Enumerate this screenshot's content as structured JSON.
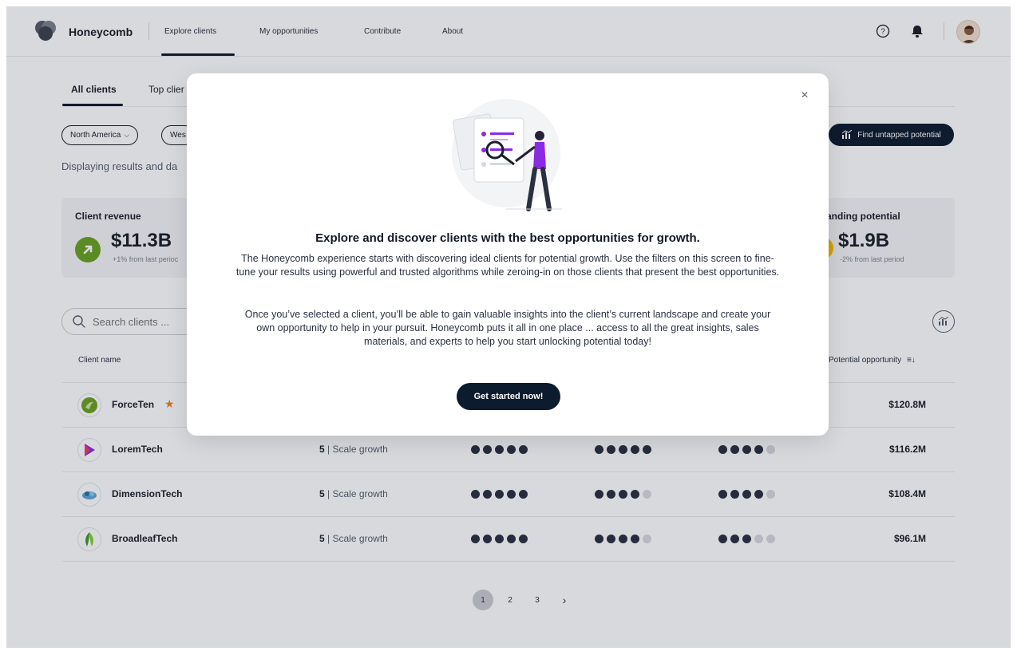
{
  "app": {
    "brand": "Honeycomb"
  },
  "nav": {
    "links": [
      "Explore clients",
      "My opportunities",
      "Contribute",
      "About"
    ],
    "active": "Explore clients"
  },
  "tabs": [
    "All clients",
    "Top clier"
  ],
  "filters": {
    "region": "North America",
    "second": "Wes",
    "cta": "Find untapped potential"
  },
  "display_text": "Displaying results and da",
  "kpis": {
    "revenue": {
      "title": "Client revenue",
      "value": "$11.3B",
      "sub": "+1% from last perioc"
    },
    "spending": {
      "title": "anding potential",
      "value": "$1.9B",
      "sub": "-2% from last period"
    }
  },
  "search": {
    "placeholder": "Search clients ..."
  },
  "table": {
    "headers": {
      "client": "Client name",
      "potential": "Potential opportunity"
    },
    "rows": [
      {
        "name": "ForceTen",
        "starred": true,
        "segment_num": "",
        "segment_text": "",
        "d1": 0,
        "d2": 0,
        "d3": 0,
        "amount": "$120.8M"
      },
      {
        "name": "LoremTech",
        "starred": false,
        "segment_num": "5",
        "segment_text": " | Scale growth",
        "d1": 5,
        "d2": 5,
        "d3": 4,
        "amount": "$116.2M"
      },
      {
        "name": "DimensionTech",
        "starred": false,
        "segment_num": "5",
        "segment_text": " | Scale growth",
        "d1": 5,
        "d2": 4,
        "d3": 4,
        "amount": "$108.4M"
      },
      {
        "name": "BroadleafTech",
        "starred": false,
        "segment_num": "5",
        "segment_text": " | Scale growth",
        "d1": 5,
        "d2": 4,
        "d3": 3,
        "amount": "$96.1M"
      }
    ]
  },
  "pagination": {
    "pages": [
      "1",
      "2",
      "3"
    ],
    "current": "1",
    "next": "›"
  },
  "modal": {
    "close": "×",
    "title": "Explore and discover clients with the best opportunities for growth.",
    "p1": "The Honeycomb experience starts with discovering ideal clients for potential growth. Use the filters on this screen to fine-tune your results using powerful and trusted algorithms while zeroing-in on those clients that present the best opportunities.",
    "p2": "Once you’ve selected a client, you’ll be able to gain valuable insights into the client’s current landscape and create your own opportunity to help in your pursuit. Honeycomb puts it all in one place ... access to all the great insights, sales materials, and experts to help you start unlocking potential today!",
    "cta": "Get started now!"
  },
  "colors": {
    "primary": "#0d1b2e",
    "accent_green": "#6aa222",
    "accent_orange": "#f2811d",
    "accent_yellow": "#f5b800"
  }
}
